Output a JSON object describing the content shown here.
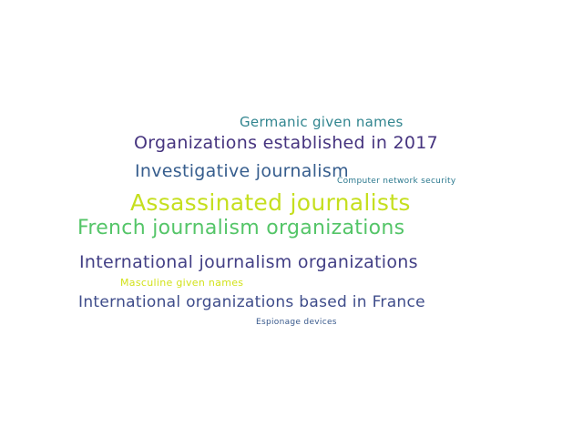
{
  "words": [
    {
      "text": "Germanic given names",
      "color": "#31858f"
    },
    {
      "text": "Organizations established in 2017",
      "color": "#46347f"
    },
    {
      "text": "Investigative journalism",
      "color": "#365d8d"
    },
    {
      "text": "Computer network security",
      "color": "#2a788e"
    },
    {
      "text": "Assassinated journalists",
      "color": "#c5df1e"
    },
    {
      "text": "French journalism organizations",
      "color": "#54c568"
    },
    {
      "text": "International journalism organizations",
      "color": "#423f85"
    },
    {
      "text": "Masculine given names",
      "color": "#d2e21b"
    },
    {
      "text": "International organizations based in France",
      "color": "#3e4c8a"
    },
    {
      "text": "Espionage devices",
      "color": "#38598c"
    }
  ]
}
